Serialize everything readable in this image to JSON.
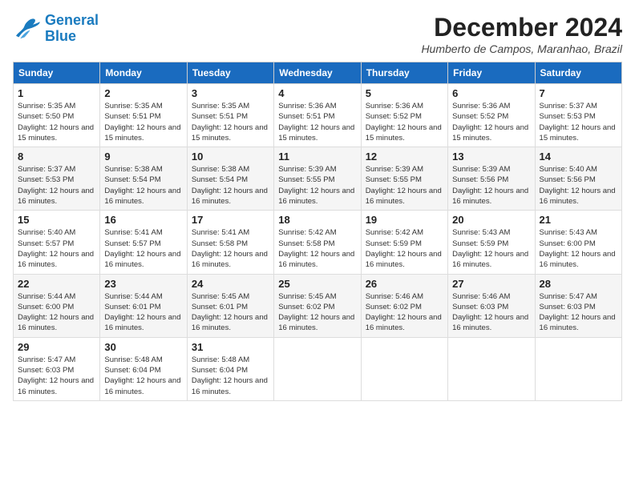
{
  "logo": {
    "line1": "General",
    "line2": "Blue"
  },
  "title": "December 2024",
  "subtitle": "Humberto de Campos, Maranhao, Brazil",
  "weekdays": [
    "Sunday",
    "Monday",
    "Tuesday",
    "Wednesday",
    "Thursday",
    "Friday",
    "Saturday"
  ],
  "weeks": [
    [
      {
        "day": "1",
        "info": "Sunrise: 5:35 AM\nSunset: 5:50 PM\nDaylight: 12 hours and 15 minutes."
      },
      {
        "day": "2",
        "info": "Sunrise: 5:35 AM\nSunset: 5:51 PM\nDaylight: 12 hours and 15 minutes."
      },
      {
        "day": "3",
        "info": "Sunrise: 5:35 AM\nSunset: 5:51 PM\nDaylight: 12 hours and 15 minutes."
      },
      {
        "day": "4",
        "info": "Sunrise: 5:36 AM\nSunset: 5:51 PM\nDaylight: 12 hours and 15 minutes."
      },
      {
        "day": "5",
        "info": "Sunrise: 5:36 AM\nSunset: 5:52 PM\nDaylight: 12 hours and 15 minutes."
      },
      {
        "day": "6",
        "info": "Sunrise: 5:36 AM\nSunset: 5:52 PM\nDaylight: 12 hours and 15 minutes."
      },
      {
        "day": "7",
        "info": "Sunrise: 5:37 AM\nSunset: 5:53 PM\nDaylight: 12 hours and 15 minutes."
      }
    ],
    [
      {
        "day": "8",
        "info": "Sunrise: 5:37 AM\nSunset: 5:53 PM\nDaylight: 12 hours and 16 minutes."
      },
      {
        "day": "9",
        "info": "Sunrise: 5:38 AM\nSunset: 5:54 PM\nDaylight: 12 hours and 16 minutes."
      },
      {
        "day": "10",
        "info": "Sunrise: 5:38 AM\nSunset: 5:54 PM\nDaylight: 12 hours and 16 minutes."
      },
      {
        "day": "11",
        "info": "Sunrise: 5:39 AM\nSunset: 5:55 PM\nDaylight: 12 hours and 16 minutes."
      },
      {
        "day": "12",
        "info": "Sunrise: 5:39 AM\nSunset: 5:55 PM\nDaylight: 12 hours and 16 minutes."
      },
      {
        "day": "13",
        "info": "Sunrise: 5:39 AM\nSunset: 5:56 PM\nDaylight: 12 hours and 16 minutes."
      },
      {
        "day": "14",
        "info": "Sunrise: 5:40 AM\nSunset: 5:56 PM\nDaylight: 12 hours and 16 minutes."
      }
    ],
    [
      {
        "day": "15",
        "info": "Sunrise: 5:40 AM\nSunset: 5:57 PM\nDaylight: 12 hours and 16 minutes."
      },
      {
        "day": "16",
        "info": "Sunrise: 5:41 AM\nSunset: 5:57 PM\nDaylight: 12 hours and 16 minutes."
      },
      {
        "day": "17",
        "info": "Sunrise: 5:41 AM\nSunset: 5:58 PM\nDaylight: 12 hours and 16 minutes."
      },
      {
        "day": "18",
        "info": "Sunrise: 5:42 AM\nSunset: 5:58 PM\nDaylight: 12 hours and 16 minutes."
      },
      {
        "day": "19",
        "info": "Sunrise: 5:42 AM\nSunset: 5:59 PM\nDaylight: 12 hours and 16 minutes."
      },
      {
        "day": "20",
        "info": "Sunrise: 5:43 AM\nSunset: 5:59 PM\nDaylight: 12 hours and 16 minutes."
      },
      {
        "day": "21",
        "info": "Sunrise: 5:43 AM\nSunset: 6:00 PM\nDaylight: 12 hours and 16 minutes."
      }
    ],
    [
      {
        "day": "22",
        "info": "Sunrise: 5:44 AM\nSunset: 6:00 PM\nDaylight: 12 hours and 16 minutes."
      },
      {
        "day": "23",
        "info": "Sunrise: 5:44 AM\nSunset: 6:01 PM\nDaylight: 12 hours and 16 minutes."
      },
      {
        "day": "24",
        "info": "Sunrise: 5:45 AM\nSunset: 6:01 PM\nDaylight: 12 hours and 16 minutes."
      },
      {
        "day": "25",
        "info": "Sunrise: 5:45 AM\nSunset: 6:02 PM\nDaylight: 12 hours and 16 minutes."
      },
      {
        "day": "26",
        "info": "Sunrise: 5:46 AM\nSunset: 6:02 PM\nDaylight: 12 hours and 16 minutes."
      },
      {
        "day": "27",
        "info": "Sunrise: 5:46 AM\nSunset: 6:03 PM\nDaylight: 12 hours and 16 minutes."
      },
      {
        "day": "28",
        "info": "Sunrise: 5:47 AM\nSunset: 6:03 PM\nDaylight: 12 hours and 16 minutes."
      }
    ],
    [
      {
        "day": "29",
        "info": "Sunrise: 5:47 AM\nSunset: 6:03 PM\nDaylight: 12 hours and 16 minutes."
      },
      {
        "day": "30",
        "info": "Sunrise: 5:48 AM\nSunset: 6:04 PM\nDaylight: 12 hours and 16 minutes."
      },
      {
        "day": "31",
        "info": "Sunrise: 5:48 AM\nSunset: 6:04 PM\nDaylight: 12 hours and 16 minutes."
      },
      null,
      null,
      null,
      null
    ]
  ]
}
